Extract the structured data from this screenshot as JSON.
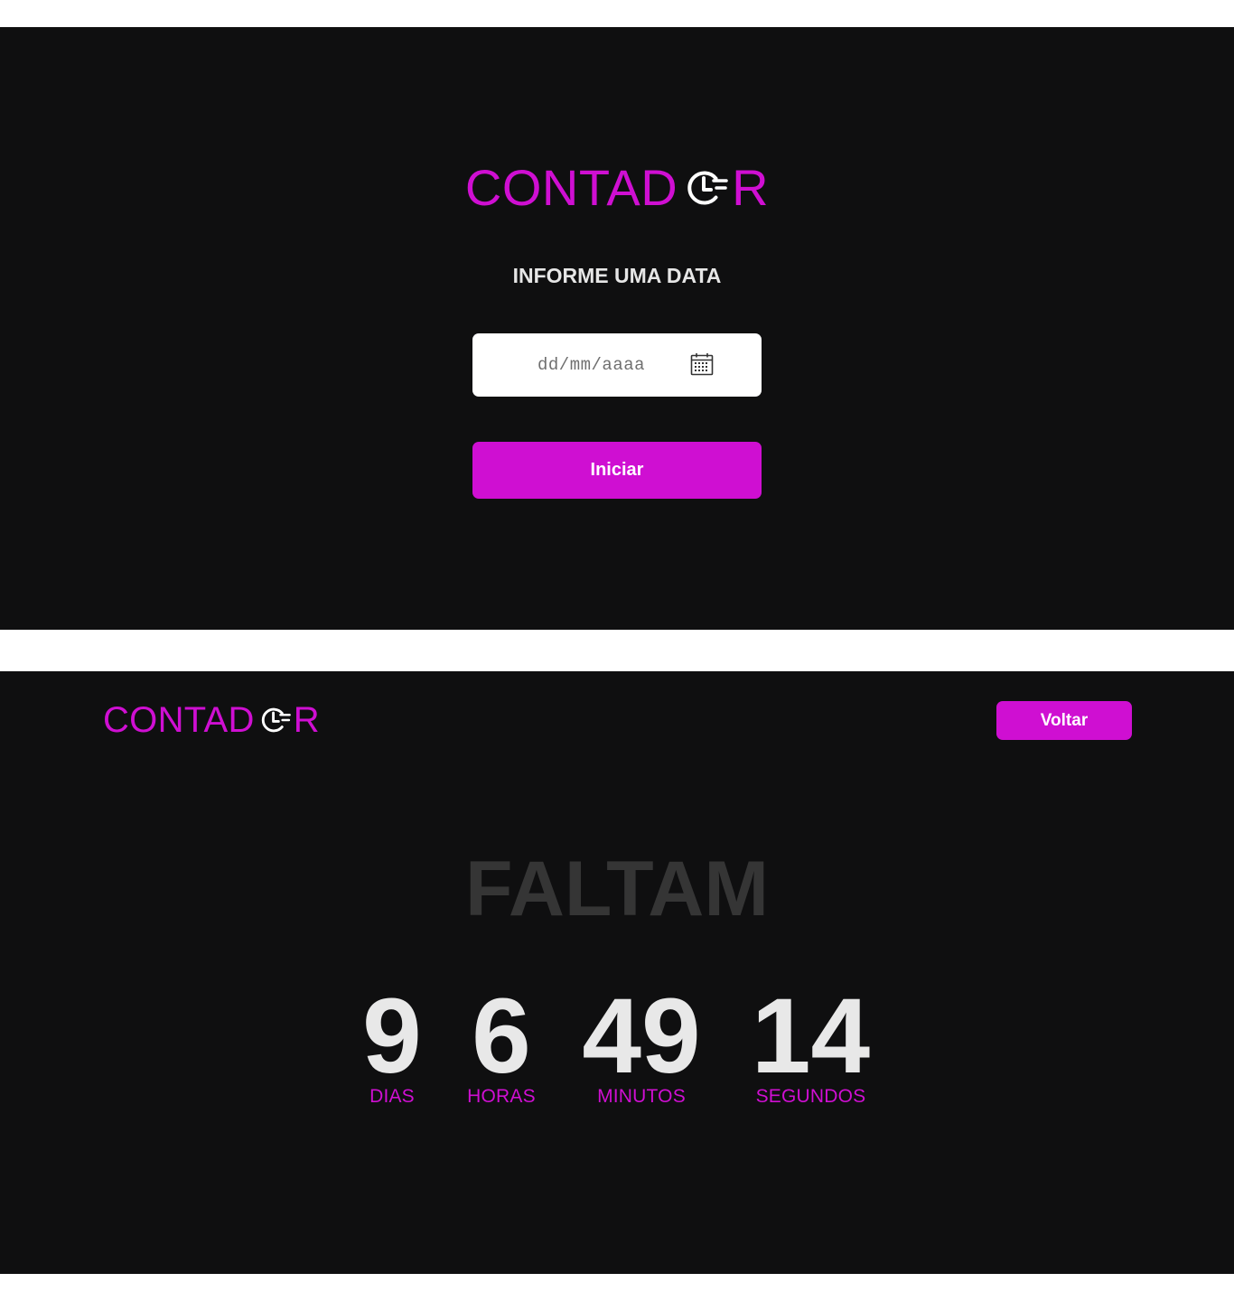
{
  "brand": {
    "logo_prefix": "CONTAD",
    "logo_suffix": "R",
    "logo_icon": "clock-icon",
    "accent_color": "#cf0fd2",
    "background_color": "#0f0f10"
  },
  "form_screen": {
    "prompt": "INFORME UMA DATA",
    "date_input": {
      "placeholder": "dd/mm/aaaa",
      "icon": "calendar-icon"
    },
    "start_button_label": "Iniciar"
  },
  "countdown_screen": {
    "back_button_label": "Voltar",
    "heading": "FALTAM",
    "units": {
      "days": {
        "value": "9",
        "label": "DIAS"
      },
      "hours": {
        "value": "6",
        "label": "HORAS"
      },
      "minutes": {
        "value": "49",
        "label": "MINUTOS"
      },
      "seconds": {
        "value": "14",
        "label": "SEGUNDOS"
      }
    }
  }
}
